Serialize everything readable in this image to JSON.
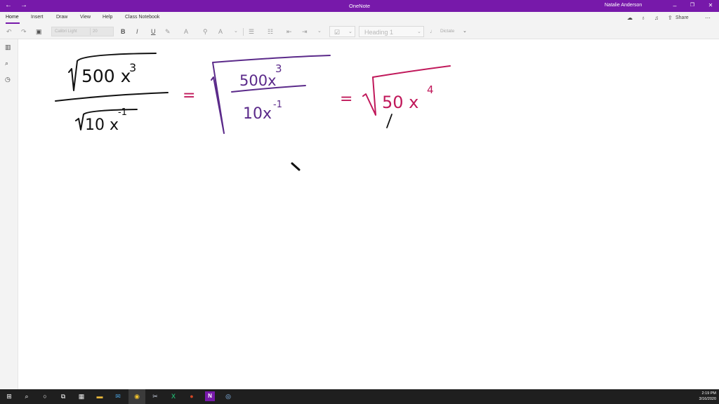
{
  "window": {
    "title": "OneNote",
    "user_name": "Natalie Anderson",
    "back_glyph": "←",
    "forward_glyph": "→",
    "minimize_glyph": "–",
    "restore_glyph": "❐",
    "close_glyph": "✕"
  },
  "ribbon": {
    "tabs": [
      "Home",
      "Insert",
      "Draw",
      "View",
      "Help",
      "Class Notebook"
    ],
    "active_tab": "Home",
    "share_label": "Share",
    "accent_color": "#7719aa"
  },
  "toolbar": {
    "font_name": "Calibri Light",
    "font_size": "20",
    "bold_label": "B",
    "italic_label": "I",
    "underline_label": "U",
    "style_value": "Heading 1",
    "dictate_label": "Dictate"
  },
  "notes": {
    "ink_colors": {
      "black": "#111111",
      "purple": "#5b2a8a",
      "magenta": "#c0185a"
    },
    "expr1_numerator": "500 x",
    "expr1_numerator_exp": "3",
    "expr1_denominator": "10 x",
    "expr1_denominator_exp": "-1",
    "eq1": "=",
    "expr2_numerator": "500x",
    "expr2_numerator_exp": "3",
    "expr2_denominator": "10x",
    "expr2_denominator_exp": "-1",
    "eq2": "=",
    "expr3_base": "50 x",
    "expr3_exp": "4"
  },
  "taskbar": {
    "time": "2:19 PM",
    "date": "3/16/2020"
  }
}
